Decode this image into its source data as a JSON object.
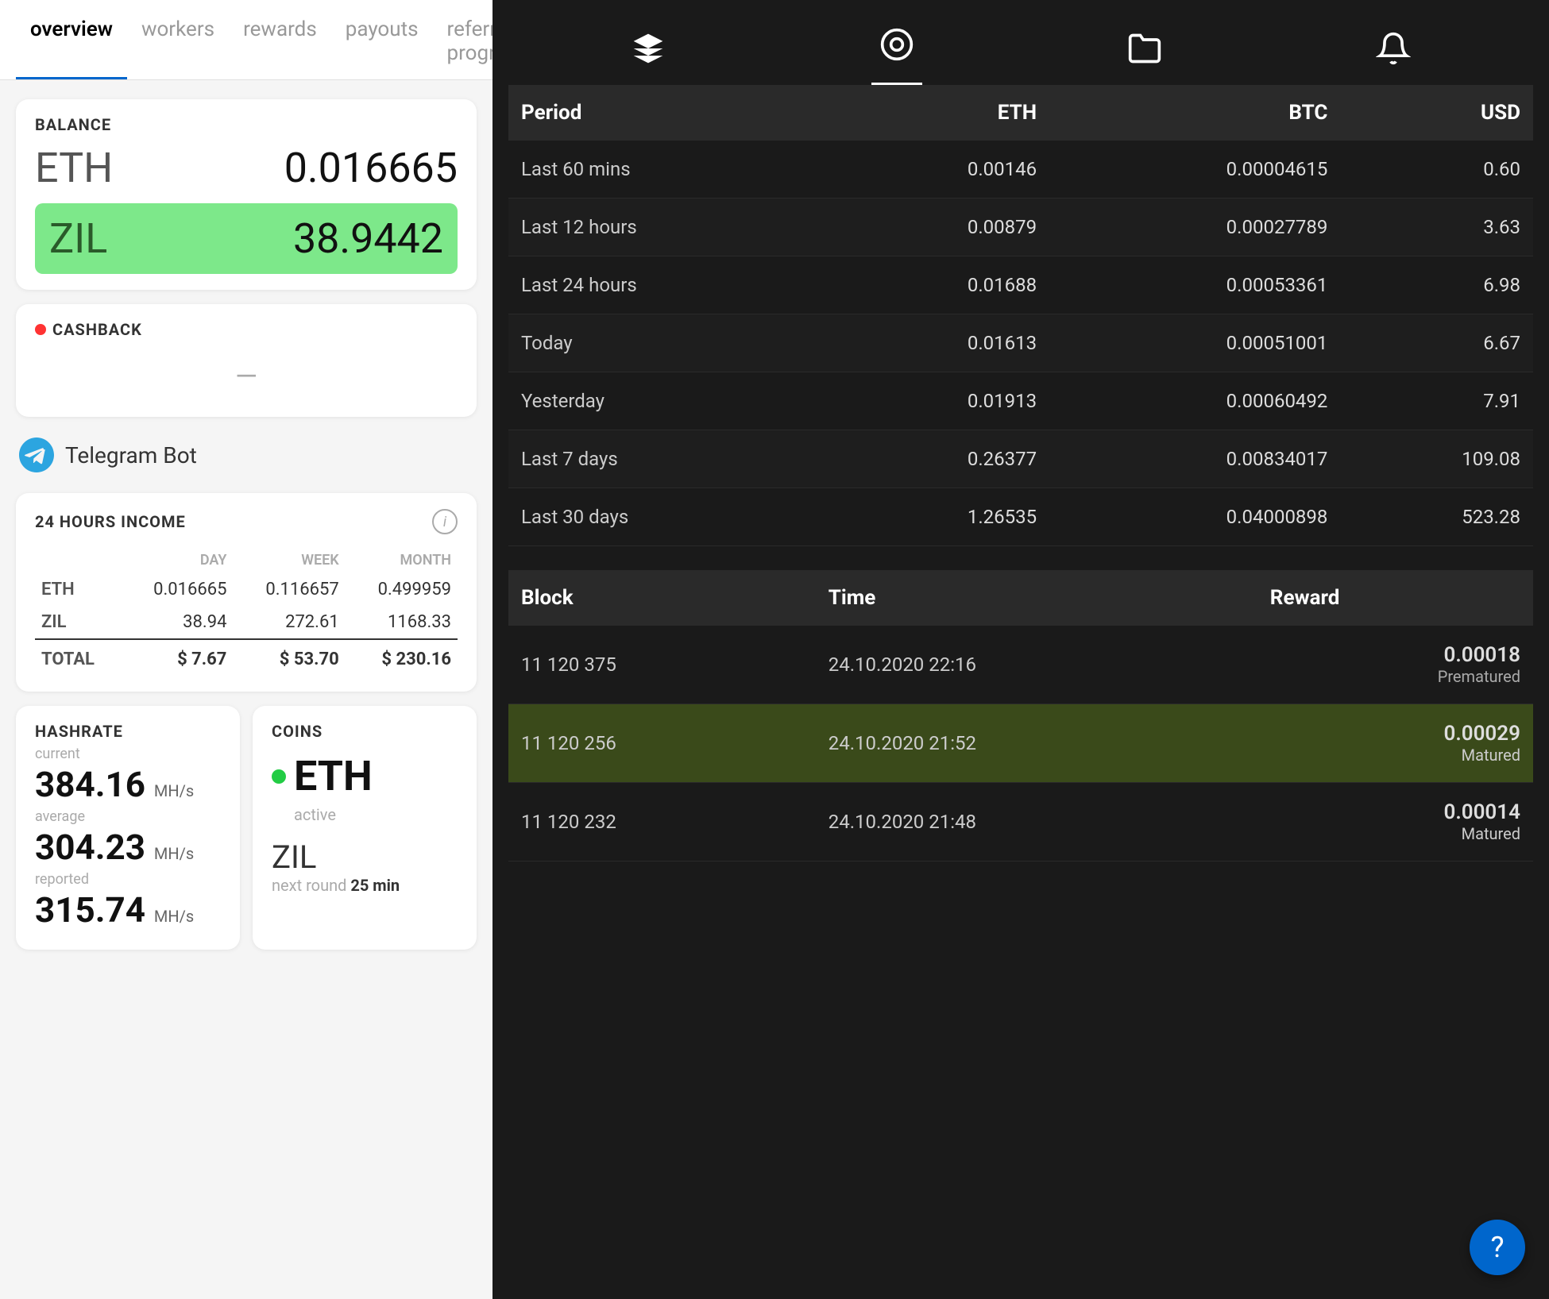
{
  "nav": {
    "tabs": [
      {
        "label": "overview",
        "active": true
      },
      {
        "label": "workers",
        "active": false
      },
      {
        "label": "rewards",
        "active": false
      },
      {
        "label": "payouts",
        "active": false
      },
      {
        "label": "referral program",
        "active": false
      }
    ]
  },
  "balance": {
    "label": "BALANCE",
    "eth_currency": "ETH",
    "eth_amount": "0.016665",
    "zil_currency": "ZIL",
    "zil_amount": "38.9442"
  },
  "cashback": {
    "label": "CASHBACK",
    "value": "—"
  },
  "telegram": {
    "label": "Telegram Bot"
  },
  "income": {
    "label": "24 HOURS INCOME",
    "col_day": "DAY",
    "col_week": "WEEK",
    "col_month": "MONTH",
    "rows": [
      {
        "currency": "ETH",
        "day": "0.016665",
        "week": "0.116657",
        "month": "0.499959"
      },
      {
        "currency": "ZIL",
        "day": "38.94",
        "week": "272.61",
        "month": "1168.33"
      },
      {
        "currency": "TOTAL",
        "day": "$ 7.67",
        "week": "$ 53.70",
        "month": "$ 230.16"
      }
    ]
  },
  "hashrate": {
    "title": "HASHRATE",
    "current_label": "current",
    "current_value": "384.16",
    "current_unit": "MH/s",
    "average_label": "average",
    "average_value": "304.23",
    "average_unit": "MH/s",
    "reported_label": "reported",
    "reported_value": "315.74",
    "reported_unit": "MH/s"
  },
  "coins": {
    "title": "COINS",
    "eth_label": "ETH",
    "eth_status": "active",
    "zil_label": "ZIL",
    "next_round_prefix": "next round",
    "next_round_value": "25 min"
  },
  "right_header": {
    "icons": [
      {
        "name": "layers-icon",
        "symbol": "⊞",
        "active": false
      },
      {
        "name": "circle-icon",
        "symbol": "◎",
        "active": true
      },
      {
        "name": "folder-icon",
        "symbol": "⊟",
        "active": false
      },
      {
        "name": "bell-icon",
        "symbol": "🔔",
        "active": false
      }
    ]
  },
  "rewards_table": {
    "columns": [
      "Period",
      "ETH",
      "BTC",
      "USD"
    ],
    "rows": [
      {
        "period": "Last 60 mins",
        "eth": "0.00146",
        "btc": "0.00004615",
        "usd": "0.60"
      },
      {
        "period": "Last 12 hours",
        "eth": "0.00879",
        "btc": "0.00027789",
        "usd": "3.63"
      },
      {
        "period": "Last 24 hours",
        "eth": "0.01688",
        "btc": "0.00053361",
        "usd": "6.98"
      },
      {
        "period": "Today",
        "eth": "0.01613",
        "btc": "0.00051001",
        "usd": "6.67"
      },
      {
        "period": "Yesterday",
        "eth": "0.01913",
        "btc": "0.00060492",
        "usd": "7.91"
      },
      {
        "period": "Last 7 days",
        "eth": "0.26377",
        "btc": "0.00834017",
        "usd": "109.08"
      },
      {
        "period": "Last 30 days",
        "eth": "1.26535",
        "btc": "0.04000898",
        "usd": "523.28"
      }
    ]
  },
  "blocks_table": {
    "columns": [
      "Block",
      "Time",
      "Reward"
    ],
    "rows": [
      {
        "block": "11 120 375",
        "time": "24.10.2020 22:16",
        "amount": "0.00018",
        "status": "Prematured",
        "highlighted": false
      },
      {
        "block": "11 120 256",
        "time": "24.10.2020 21:52",
        "amount": "0.00029",
        "status": "Matured",
        "highlighted": true
      },
      {
        "block": "11 120 232",
        "time": "24.10.2020 21:48",
        "amount": "0.00014",
        "status": "Matured",
        "highlighted": false
      }
    ]
  }
}
